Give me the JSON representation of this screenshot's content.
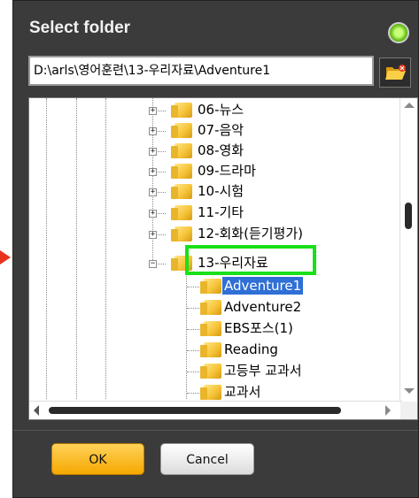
{
  "dialog": {
    "title": "Select folder",
    "path_value": "D:\\arls\\영어훈련\\13-우리자료\\Adventure1"
  },
  "tree": {
    "items": [
      {
        "label": "06-뉴스",
        "expander": "+"
      },
      {
        "label": "07-음악",
        "expander": "+"
      },
      {
        "label": "08-영화",
        "expander": "+"
      },
      {
        "label": "09-드라마",
        "expander": "+"
      },
      {
        "label": "10-시험",
        "expander": "+"
      },
      {
        "label": "11-기타",
        "expander": "+"
      },
      {
        "label": "12-회화(듣기평가)",
        "expander": "+"
      },
      {
        "label": "13-우리자료",
        "expander": "−"
      }
    ],
    "children": [
      {
        "label": "Adventure1",
        "selected": true
      },
      {
        "label": "Adventure2"
      },
      {
        "label": "EBS포스(1)"
      },
      {
        "label": "Reading"
      },
      {
        "label": "고등부 교과서"
      },
      {
        "label": "교과서"
      }
    ]
  },
  "buttons": {
    "ok_label": "OK",
    "cancel_label": "Cancel"
  },
  "icons": {
    "close": "close-icon",
    "browse_folder": "folder-open-icon",
    "folder": "folder-icon"
  },
  "colors": {
    "dialog_bg": "#3b3b3b",
    "highlight": "#19e019",
    "selection": "#2f6fd6",
    "ok_button": "#f5a800",
    "pointer_arrow": "#e8321e"
  }
}
